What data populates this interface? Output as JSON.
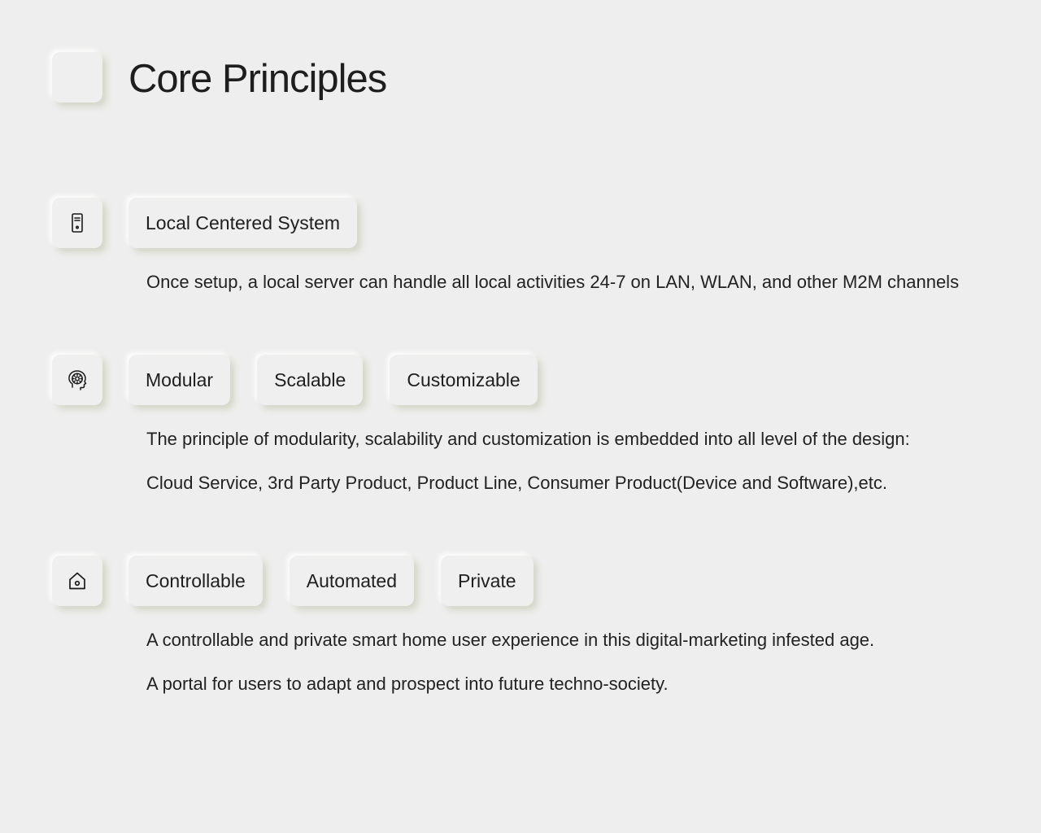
{
  "header": {
    "title": "Core Principles"
  },
  "sections": [
    {
      "icon": "server-icon",
      "tags": [
        "Local Centered System"
      ],
      "lines": [
        "Once setup, a local server can handle all local activities 24-7 on LAN, WLAN, and other M2M channels"
      ]
    },
    {
      "icon": "head-gear-icon",
      "tags": [
        "Modular",
        "Scalable",
        "Customizable"
      ],
      "lines": [
        "The principle of modularity, scalability and customization is embedded into all level of the design:",
        "Cloud Service, 3rd Party Product, Product Line, Consumer Product(Device and Software),etc."
      ]
    },
    {
      "icon": "home-icon",
      "tags": [
        "Controllable",
        "Automated",
        "Private"
      ],
      "lines": [
        "A controllable and private smart home user experience in this digital-marketing infested age.",
        "A portal for users to adapt and prospect into future techno-society."
      ]
    }
  ],
  "colors": {
    "background": "#eeeeee",
    "text": "#1f1f1f"
  }
}
